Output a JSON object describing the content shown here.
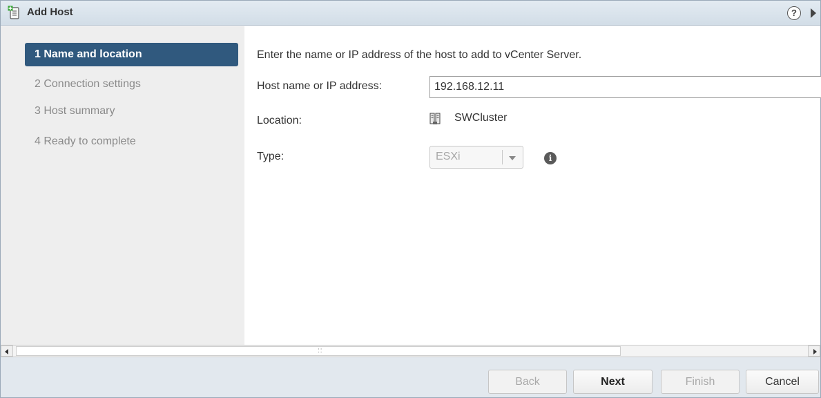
{
  "window": {
    "title": "Add Host",
    "help_label": "?"
  },
  "steps": [
    {
      "label": "1  Name and location",
      "active": true
    },
    {
      "label": "2  Connection settings",
      "active": false
    },
    {
      "label": "3  Host summary",
      "active": false
    },
    {
      "label": "4  Ready to complete",
      "active": false
    }
  ],
  "form": {
    "intro": "Enter the name or IP address of the host to add to vCenter Server.",
    "host_label": "Host name or IP address:",
    "host_value": "192.168.12.11",
    "location_label": "Location:",
    "location_value": "SWCluster",
    "type_label": "Type:",
    "type_value": "ESXi",
    "info_glyph": "i"
  },
  "scrollbar": {
    "grip": "::"
  },
  "buttons": {
    "back": "Back",
    "next": "Next",
    "finish": "Finish",
    "cancel": "Cancel"
  },
  "colors": {
    "active_step": "#30597e",
    "title_bar": "#d9e3ec",
    "footer": "#e2e8ee"
  },
  "icons": [
    "add-host-icon",
    "help-icon",
    "more-arrow-icon",
    "cluster-icon",
    "dropdown-caret-icon",
    "info-icon",
    "scroll-left-icon",
    "scroll-right-icon"
  ]
}
